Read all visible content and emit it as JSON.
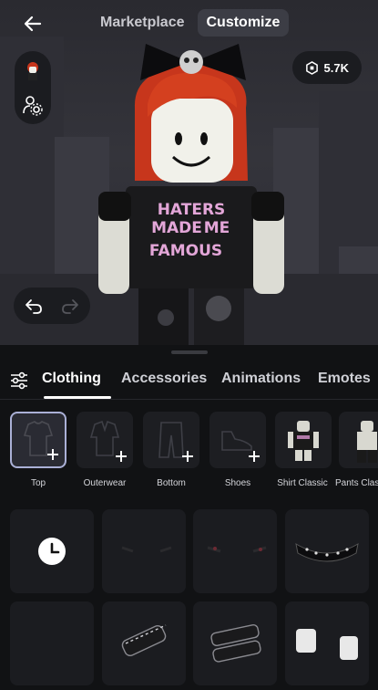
{
  "header": {
    "tabs": [
      {
        "label": "Marketplace",
        "active": false
      },
      {
        "label": "Customize",
        "active": true
      }
    ]
  },
  "robux": {
    "balance": "5.7K"
  },
  "shirt_text": [
    "HATERS",
    "MADE",
    "ME",
    "FAMOUS"
  ],
  "categories": [
    {
      "label": "Clothing",
      "active": true
    },
    {
      "label": "Accessories",
      "active": false
    },
    {
      "label": "Animations",
      "active": false
    },
    {
      "label": "Emotes",
      "active": false
    }
  ],
  "subcategories": [
    {
      "label": "Top",
      "active": true
    },
    {
      "label": "Outerwear",
      "active": false
    },
    {
      "label": "Bottom",
      "active": false
    },
    {
      "label": "Shoes",
      "active": false
    },
    {
      "label": "Shirt Classic",
      "active": false
    },
    {
      "label": "Pants Classic",
      "active": false
    }
  ],
  "colors": {
    "accent": "#aab0d6",
    "panel": "#111214",
    "card": "#1b1c20"
  }
}
